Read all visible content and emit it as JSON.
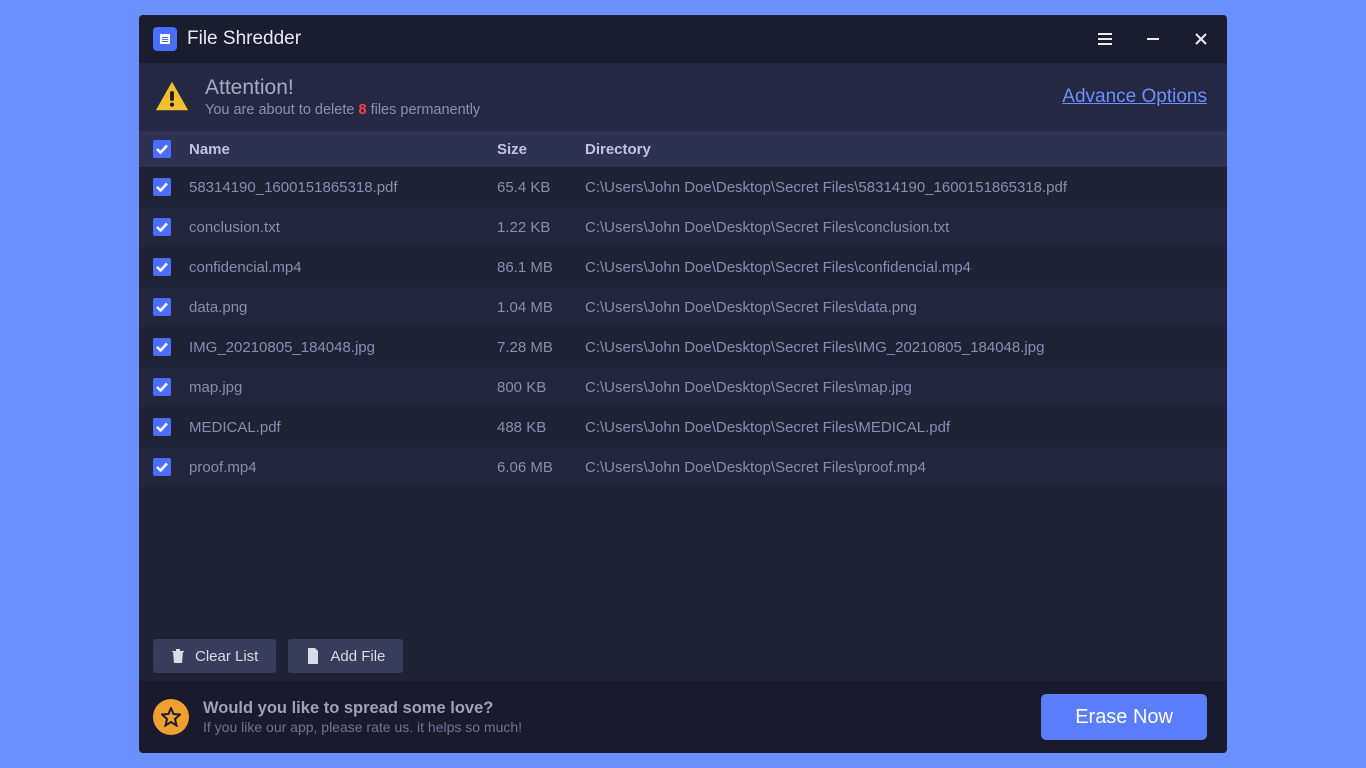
{
  "app": {
    "title": "File Shredder"
  },
  "attention": {
    "title": "Attention!",
    "prefix": "You are about to delete ",
    "count": "8",
    "suffix": " files permanently",
    "advance_label": "Advance Options"
  },
  "columns": {
    "name": "Name",
    "size": "Size",
    "directory": "Directory"
  },
  "files": [
    {
      "name": "58314190_1600151865318.pdf",
      "size": "65.4 KB",
      "dir": "C:\\Users\\John Doe\\Desktop\\Secret Files\\58314190_1600151865318.pdf"
    },
    {
      "name": "conclusion.txt",
      "size": "1.22 KB",
      "dir": "C:\\Users\\John Doe\\Desktop\\Secret Files\\conclusion.txt"
    },
    {
      "name": "confidencial.mp4",
      "size": "86.1 MB",
      "dir": "C:\\Users\\John Doe\\Desktop\\Secret Files\\confidencial.mp4"
    },
    {
      "name": "data.png",
      "size": "1.04 MB",
      "dir": "C:\\Users\\John Doe\\Desktop\\Secret Files\\data.png"
    },
    {
      "name": "IMG_20210805_184048.jpg",
      "size": "7.28 MB",
      "dir": "C:\\Users\\John Doe\\Desktop\\Secret Files\\IMG_20210805_184048.jpg"
    },
    {
      "name": "map.jpg",
      "size": "800 KB",
      "dir": "C:\\Users\\John Doe\\Desktop\\Secret Files\\map.jpg"
    },
    {
      "name": "MEDICAL.pdf",
      "size": "488 KB",
      "dir": "C:\\Users\\John Doe\\Desktop\\Secret Files\\MEDICAL.pdf"
    },
    {
      "name": "proof.mp4",
      "size": "6.06 MB",
      "dir": "C:\\Users\\John Doe\\Desktop\\Secret Files\\proof.mp4"
    }
  ],
  "actions": {
    "clear": "Clear List",
    "add": "Add File"
  },
  "footer": {
    "title": "Would you like to spread some love?",
    "sub": "If you like our app, please rate us. it helps so much!",
    "erase": "Erase Now"
  }
}
